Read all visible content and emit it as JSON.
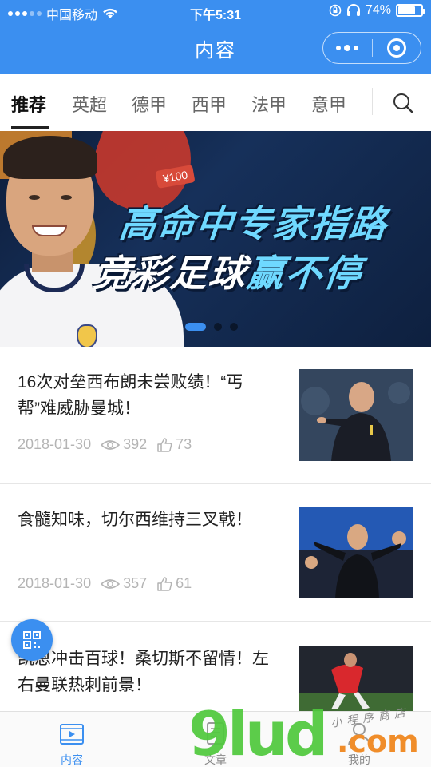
{
  "status_bar": {
    "carrier": "中国移动",
    "time": "下午5:31",
    "battery": "74%",
    "battery_level": 0.74
  },
  "title_bar": {
    "title": "内容"
  },
  "tabs": [
    {
      "label": "推荐",
      "active": true
    },
    {
      "label": "英超",
      "active": false
    },
    {
      "label": "德甲",
      "active": false
    },
    {
      "label": "西甲",
      "active": false
    },
    {
      "label": "法甲",
      "active": false
    },
    {
      "label": "意甲",
      "active": false
    }
  ],
  "banner": {
    "tag": "¥100",
    "line1": "高命中专家指路",
    "line2_a": "竞彩足球",
    "line2_b": "赢不停",
    "slide_count": 3,
    "active_slide": 1
  },
  "articles": [
    {
      "title": "16次对垒西布朗未尝败绩！“丐帮”难威胁曼城！",
      "date": "2018-01-30",
      "views": "392",
      "likes": "73"
    },
    {
      "title": "食髓知味，切尔西维持三叉戟！",
      "date": "2018-01-30",
      "views": "357",
      "likes": "61"
    },
    {
      "title": "凯恩冲击百球！桑切斯不留情！左右曼联热刺前景！",
      "date": "",
      "views": "",
      "likes": ""
    }
  ],
  "bottom_nav": [
    {
      "label": "内容",
      "icon": "video-icon",
      "active": true
    },
    {
      "label": "文章",
      "icon": "article-icon",
      "active": false
    },
    {
      "label": "我的",
      "icon": "user-icon",
      "active": false
    }
  ],
  "watermark": {
    "brand": "9lud",
    "domain": ".com",
    "subtitle": "小程序商店"
  },
  "colors": {
    "primary": "#3b8ff0",
    "text": "#222222",
    "meta": "#b4b4b4"
  }
}
